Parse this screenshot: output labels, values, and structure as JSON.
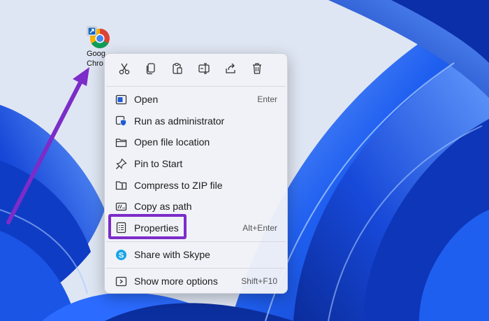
{
  "colors": {
    "wallpaper_base": "#dfe6f3",
    "bloom_dark": "#0b2fa8",
    "bloom_mid": "#1f5ff0",
    "bloom_light": "#8ab8ff",
    "menu_bg": "#f0f2f8",
    "highlight": "#7b2cc9",
    "arrow": "#7b2cc9"
  },
  "desktop_icon": {
    "icon": "chrome-shortcut-icon",
    "label_line1": "Goog",
    "label_line2": "Chro"
  },
  "context_menu": {
    "toolbar": [
      {
        "name": "cut-icon",
        "label": "Cut"
      },
      {
        "name": "copy-icon",
        "label": "Copy"
      },
      {
        "name": "paste-icon",
        "label": "Paste"
      },
      {
        "name": "rename-icon",
        "label": "Rename"
      },
      {
        "name": "share-icon",
        "label": "Share"
      },
      {
        "name": "delete-icon",
        "label": "Delete"
      }
    ],
    "items": [
      {
        "icon": "open-icon",
        "label": "Open",
        "shortcut": "Enter"
      },
      {
        "icon": "shield-icon",
        "label": "Run as administrator",
        "shortcut": ""
      },
      {
        "icon": "folder-icon",
        "label": "Open file location",
        "shortcut": ""
      },
      {
        "icon": "pin-icon",
        "label": "Pin to Start",
        "shortcut": ""
      },
      {
        "icon": "zip-icon",
        "label": "Compress to ZIP file",
        "shortcut": ""
      },
      {
        "icon": "path-icon",
        "label": "Copy as path",
        "shortcut": ""
      },
      {
        "icon": "properties-icon",
        "label": "Properties",
        "shortcut": "Alt+Enter"
      }
    ],
    "skype_item": {
      "icon": "skype-icon",
      "label": "Share with Skype"
    },
    "more_item": {
      "icon": "more-options-icon",
      "label": "Show more options",
      "shortcut": "Shift+F10"
    }
  }
}
